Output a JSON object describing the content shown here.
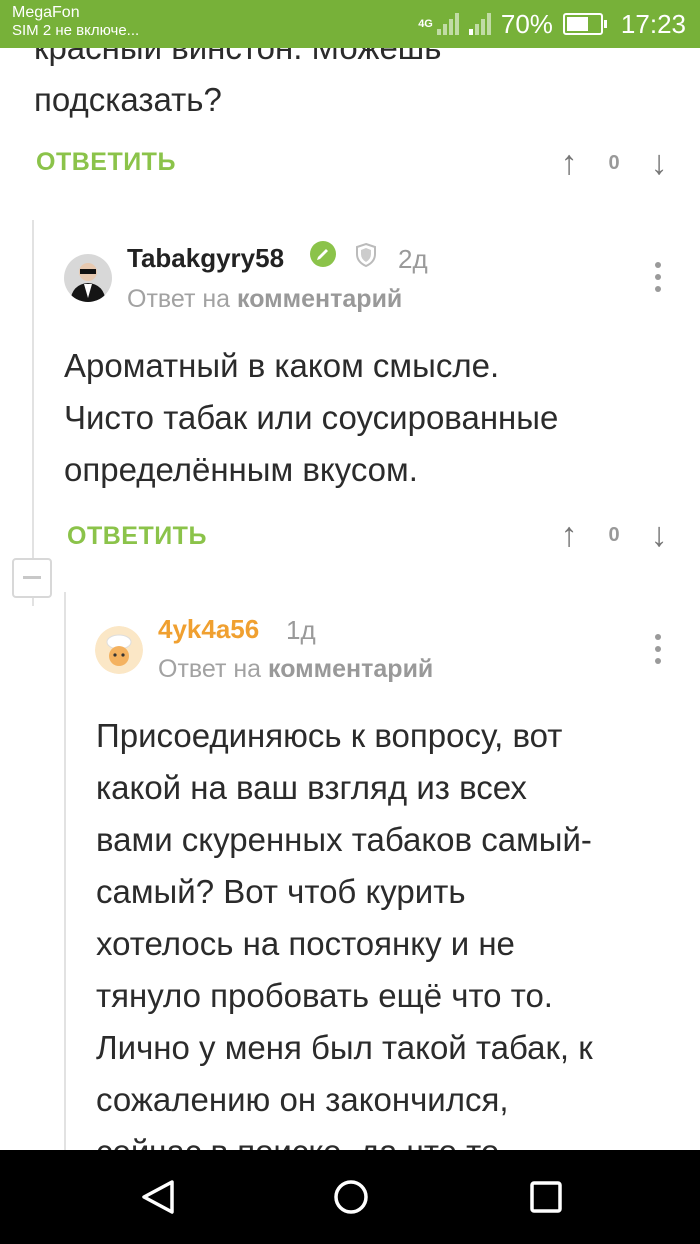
{
  "status_bar": {
    "carrier": "MegaFon",
    "sim2": "SIM 2 не включе...",
    "network_type": "4G",
    "battery": "70%",
    "battery_level": 0.7,
    "time": "17:23"
  },
  "top_comment": {
    "text_lines": [
      "красный винстон. Можешь",
      "подсказать?"
    ],
    "reply_label": "ОТВЕТИТЬ",
    "rating": "0"
  },
  "comment_1": {
    "username": "Tabakgyry58",
    "time": "2д",
    "reply_to_prefix": "Ответ на",
    "reply_to_link": "комментарий",
    "text_lines": [
      "Ароматный в каком смысле.",
      "Чисто табак или соусированные",
      "определённым вкусом."
    ],
    "reply_label": "ОТВЕТИТЬ",
    "rating": "0"
  },
  "comment_2": {
    "username": "4yk4a56",
    "time": "1д",
    "reply_to_prefix": "Ответ на",
    "reply_to_link": "комментарий",
    "text_lines": [
      "Присоединяюсь к вопросу, вот",
      "какой на ваш взгляд из всех",
      "вами скуренных табаков самый-",
      "самый? Вот чтоб курить",
      "хотелось на постоянку и не",
      "тянуло пробовать ещё что то.",
      "Лично у меня был такой табак, к",
      "сожалению он закончился,",
      "сейчас в поиске, да что то"
    ]
  },
  "icons": {
    "upvote": "arrow-up-icon",
    "downvote": "arrow-down-icon",
    "verified": "check-badge-icon",
    "shield": "shield-icon",
    "more": "kebab-menu-icon",
    "collapse": "minus-icon",
    "nav_back": "back-triangle-icon",
    "nav_home": "home-circle-icon",
    "nav_recent": "recent-square-icon"
  },
  "colors": {
    "status_bar": "#77b139",
    "accent_green": "#8bc34a",
    "username_orange": "#f0a030",
    "text": "#2b2b2b",
    "muted": "#a2a2a2"
  }
}
